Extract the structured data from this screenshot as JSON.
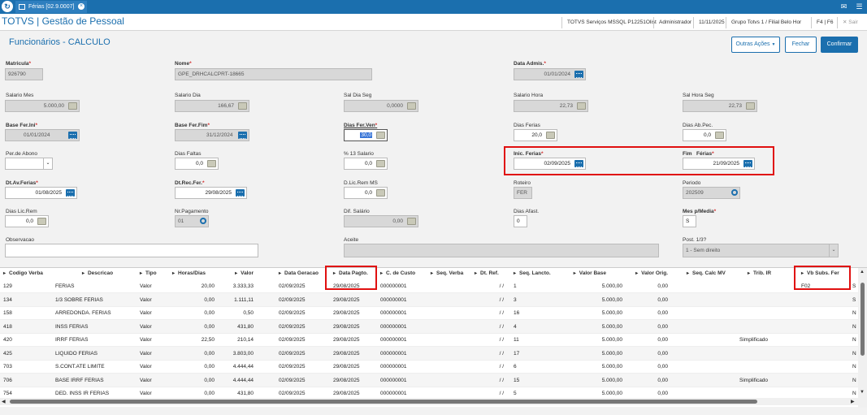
{
  "topbar": {
    "tab_label": "Férias [02.9.0007]",
    "mail_icon": "mail-icon",
    "menu_icon": "hamburger-menu-icon"
  },
  "header": {
    "app_title": "TOTVS | Gestão de Pessoal",
    "server": "TOTVS Serviços MSSQL P12251Olist",
    "user": "Administrador",
    "date": "11/11/2025",
    "branch": "Grupo Totvs 1 / Filial Belo Hor",
    "shortcut": "F4 | F6",
    "exit_label": "Sair"
  },
  "page": {
    "title": "Funcionários - CALCULO",
    "other_actions": "Outras Ações",
    "close": "Fechar",
    "confirm": "Confirmar"
  },
  "form": {
    "matricula": {
      "label": "Matricula",
      "value": "926790"
    },
    "nome": {
      "label": "Nome",
      "value": "GPE_DRHCALCPRT-18665"
    },
    "data_admis": {
      "label": "Data Admis.",
      "value": "01/01/2024"
    },
    "salario_mes": {
      "label": "Salario Mes",
      "value": "5.000,00"
    },
    "salario_dia": {
      "label": "Salario Dia",
      "value": "166,67"
    },
    "sal_dia_seg": {
      "label": "Sal Dia Seg",
      "value": "0,0000"
    },
    "salario_hora": {
      "label": "Salario Hora",
      "value": "22,73"
    },
    "sal_hora_seg": {
      "label": "Sal Hora Seg",
      "value": "22,73"
    },
    "base_fer_ini": {
      "label": "Base Fer.Ini",
      "value": "01/01/2024"
    },
    "base_fer_fim": {
      "label": "Base Fer.Fim",
      "value": "31/12/2024"
    },
    "dias_fer_ven": {
      "label": "Dias Fer.Ven",
      "value": "30,0"
    },
    "dias_ferias": {
      "label": "Dias Ferias",
      "value": "20,0"
    },
    "dias_ab_pec": {
      "label": "Dias Ab.Pec.",
      "value": "0,0"
    },
    "per_abono": {
      "label": "Per.de Abono",
      "value": ""
    },
    "dias_faltas": {
      "label": "Dias Faltas",
      "value": "0,0"
    },
    "pct_13_salario": {
      "label": "% 13 Salario",
      "value": "0,0"
    },
    "inic_ferias": {
      "label": "Inic. Ferias",
      "value": "02/09/2025"
    },
    "fim_ferias": {
      "label": "Fim   Férias",
      "value": "21/09/2025"
    },
    "dt_av_ferias": {
      "label": "Dt.Av.Ferias",
      "value": "01/08/2025"
    },
    "dt_rec_fer": {
      "label": "Dt.Rec.Fer.",
      "value": "29/08/2025"
    },
    "d_lic_rem_ms": {
      "label": "D.Lic.Rem MS",
      "value": "0,0"
    },
    "roteiro": {
      "label": "Roteiro",
      "value": "FER"
    },
    "periodo": {
      "label": "Periodo",
      "value": "202509"
    },
    "dias_lic_rem": {
      "label": "Dias Lic.Rem",
      "value": "0,0"
    },
    "nr_pagamento": {
      "label": "Nr.Pagamento",
      "value": "01"
    },
    "dif_salario": {
      "label": "Dif. Salário",
      "value": "0,00"
    },
    "dias_afast": {
      "label": "Dias Afast.",
      "value": "0"
    },
    "mes_p_media": {
      "label": "Mes p/Media",
      "value": "S"
    },
    "observacao": {
      "label": "Observacao",
      "value": ""
    },
    "aceite": {
      "label": "Aceite",
      "value": ""
    },
    "post_13": {
      "label": "Post. 1/3?",
      "value": "1 - Sem direito"
    }
  },
  "grid": {
    "headers": [
      "Codigo Verba",
      "Descricao",
      "Tipo",
      "Horas/Dias",
      "Valor",
      "Data Geracao",
      "Data Pagto.",
      "C. de Custo",
      "Seq. Verba",
      "Dt. Ref.",
      "Seq. Lancto.",
      "Valor Base",
      "Valor Orig.",
      "Seq. Calc MV",
      "Trib. IR",
      "Vb Subs. Fer"
    ],
    "rows": [
      [
        "129",
        "FERIAS",
        "Valor",
        "20,00",
        "3.333,33",
        "02/09/2025",
        "29/08/2025",
        "000000001",
        "",
        "/ /",
        "1",
        "5.000,00",
        "0,00",
        "",
        "",
        "F02",
        "S"
      ],
      [
        "134",
        "1/3 SOBRE FERIAS",
        "Valor",
        "0,00",
        "1.111,11",
        "02/09/2025",
        "29/08/2025",
        "000000001",
        "",
        "/ /",
        "3",
        "5.000,00",
        "0,00",
        "",
        "",
        "",
        "S"
      ],
      [
        "158",
        "ARREDONDA. FERIAS",
        "Valor",
        "0,00",
        "0,50",
        "02/09/2025",
        "29/08/2025",
        "000000001",
        "",
        "/ /",
        "16",
        "5.000,00",
        "0,00",
        "",
        "",
        "",
        "N"
      ],
      [
        "418",
        "INSS FERIAS",
        "Valor",
        "0,00",
        "431,80",
        "02/09/2025",
        "29/08/2025",
        "000000001",
        "",
        "/ /",
        "4",
        "5.000,00",
        "0,00",
        "",
        "",
        "",
        "N"
      ],
      [
        "420",
        "IRRF FERIAS",
        "Valor",
        "22,50",
        "210,14",
        "02/09/2025",
        "29/08/2025",
        "000000001",
        "",
        "/ /",
        "11",
        "5.000,00",
        "0,00",
        "",
        "Simplificado",
        "",
        "N"
      ],
      [
        "425",
        "LIQUIDO FERIAS",
        "Valor",
        "0,00",
        "3.803,00",
        "02/09/2025",
        "29/08/2025",
        "000000001",
        "",
        "/ /",
        "17",
        "5.000,00",
        "0,00",
        "",
        "",
        "",
        "N"
      ],
      [
        "703",
        "S.CONT.ATE LIMITE",
        "Valor",
        "0,00",
        "4.444,44",
        "02/09/2025",
        "29/08/2025",
        "000000001",
        "",
        "/ /",
        "6",
        "5.000,00",
        "0,00",
        "",
        "",
        "",
        "N"
      ],
      [
        "706",
        "BASE IRRF FERIAS",
        "Valor",
        "0,00",
        "4.444,44",
        "02/09/2025",
        "29/08/2025",
        "000000001",
        "",
        "/ /",
        "15",
        "5.000,00",
        "0,00",
        "",
        "Simplificado",
        "",
        "N"
      ],
      [
        "754",
        "DED. INSS IR FERIAS",
        "Valor",
        "0,00",
        "431,80",
        "02/09/2025",
        "29/08/2025",
        "000000001",
        "",
        "/ /",
        "5",
        "5.000,00",
        "0,00",
        "",
        "",
        "",
        "N"
      ]
    ]
  },
  "colors": {
    "brand": "#1b6fae",
    "highlight": "#e01010",
    "required": "#d32f2f"
  }
}
